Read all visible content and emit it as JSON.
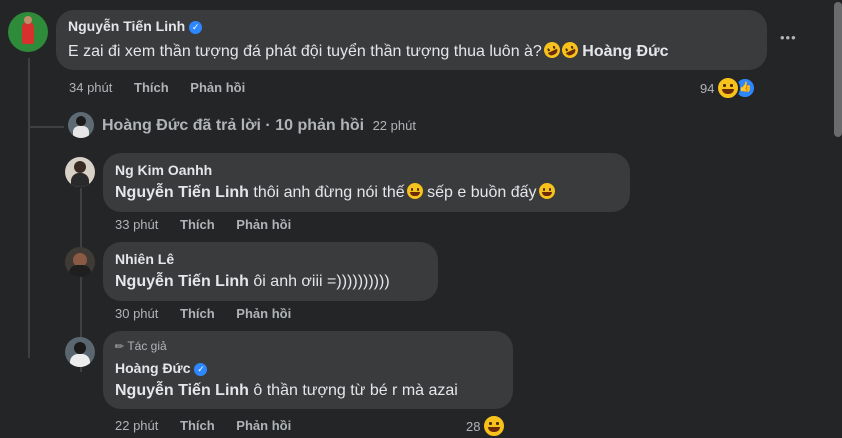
{
  "comment": {
    "author": "Nguyễn Tiến Linh",
    "verified_mark": "✓",
    "text": "E zai đi xem thần tượng đá phát đội tuyển thần tượng thua luôn à?",
    "mention": "Hoàng Đức",
    "time": "34 phút",
    "like_label": "Thích",
    "reply_label": "Phản hồi",
    "reaction_count": "94",
    "more_icon": "•••"
  },
  "reply_summary": {
    "text": "Hoàng Đức đã trả lời · 10 phản hồi",
    "time": "22 phút"
  },
  "replies": [
    {
      "author": "Ng Kim Oanhh",
      "mention": "Nguyễn Tiến Linh",
      "text_part1": "thôi anh đừng nói thế",
      "text_part2": "sếp e buồn đấy",
      "time": "33 phút",
      "like_label": "Thích",
      "reply_label": "Phản hồi"
    },
    {
      "author": "Nhiên Lê",
      "mention": "Nguyễn Tiến Linh",
      "text": "ôi anh ơiii =))))))))))",
      "time": "30 phút",
      "like_label": "Thích",
      "reply_label": "Phản hồi"
    },
    {
      "author_badge": "Tác giả",
      "author": "Hoàng Đức",
      "verified_mark": "✓",
      "mention": "Nguyễn Tiến Linh",
      "text": "ô thần tượng từ bé r mà azai",
      "time": "22 phút",
      "like_label": "Thích",
      "reply_label": "Phản hồi",
      "reaction_count": "28"
    }
  ],
  "colors": {
    "background": "#242526",
    "bubble": "#3a3b3c",
    "text_primary": "#e4e6eb",
    "text_secondary": "#b0b3b8",
    "verified_blue": "#2d88ff"
  }
}
